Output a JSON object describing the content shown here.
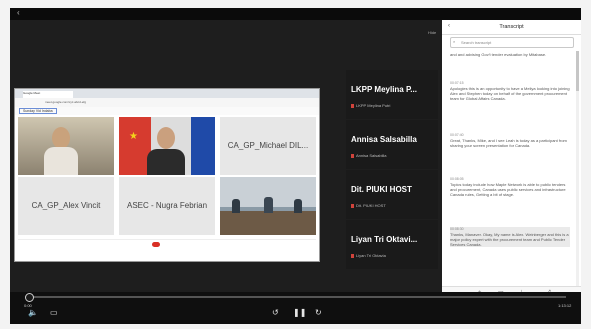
{
  "player": {
    "back_glyph": "‹",
    "exit_label": "Hide",
    "time_current": "0:00",
    "time_total": "1:13:12",
    "progress_fraction": 0.003,
    "icons": {
      "volume": "speaker-icon",
      "captions": "captions-icon",
      "rewind": "rewind-icon",
      "pause": "pause-icon",
      "forward": "forward-icon",
      "next": "chevron-right-icon"
    }
  },
  "shared_screen": {
    "browser_tab": "Google Meet",
    "url": "meet.google.com/xyz-abcd-efg",
    "meeting_label": "Sunday Vid Indaba",
    "tiles": [
      {
        "name": "",
        "tag": ""
      },
      {
        "name": "",
        "tag": ""
      },
      {
        "name": "CA_GP_Michael DIL...",
        "tag": ""
      },
      {
        "name": "CA_GP_Alex Vincit",
        "tag": ""
      },
      {
        "name": "ASEC - Nugra Febrian",
        "tag": ""
      },
      {
        "name": "",
        "tag": ""
      }
    ]
  },
  "participants": [
    {
      "name": "LKPP Meylina P...",
      "sub": "LKPP Meylina Putri"
    },
    {
      "name": "Annisa Salsabilla",
      "sub": "Annisa Salsabilla"
    },
    {
      "name": "Dit. PIUKI HOST",
      "sub": "Dit. PIUKI HOST"
    },
    {
      "name": "Liyan Tri Oktavi...",
      "sub": "Liyan Tri Oktavia"
    }
  ],
  "transcript": {
    "title": "Transcript",
    "search_placeholder": "Search transcript",
    "entries": [
      {
        "time": "",
        "text": "and and advising Gov't tender evaluation by Mitabase."
      },
      {
        "time": "00:07:15",
        "text": "Apologies this is an opportunity to have a Meliya looking into joining Alex and Stephen today on behalf of the government procurement team for Global Affairs Canada."
      },
      {
        "time": "00:07:40",
        "text": "Great, Thanks, Mike, and I see Leah is today as a participant from sharing your screen presentation for Canada."
      },
      {
        "time": "00:08:05",
        "text": "Topics today include how Maple Network is able to public tenders and procurement, Canada uses public services and infrastructure Canada rules, Getting a bit of stage."
      },
      {
        "time": "00:08:30",
        "text": "Thanks, Manaver. Okay, My name is Alex. Weinberger and this is a major policy expert with the procurement team and Public Tender Services Canada."
      }
    ]
  }
}
